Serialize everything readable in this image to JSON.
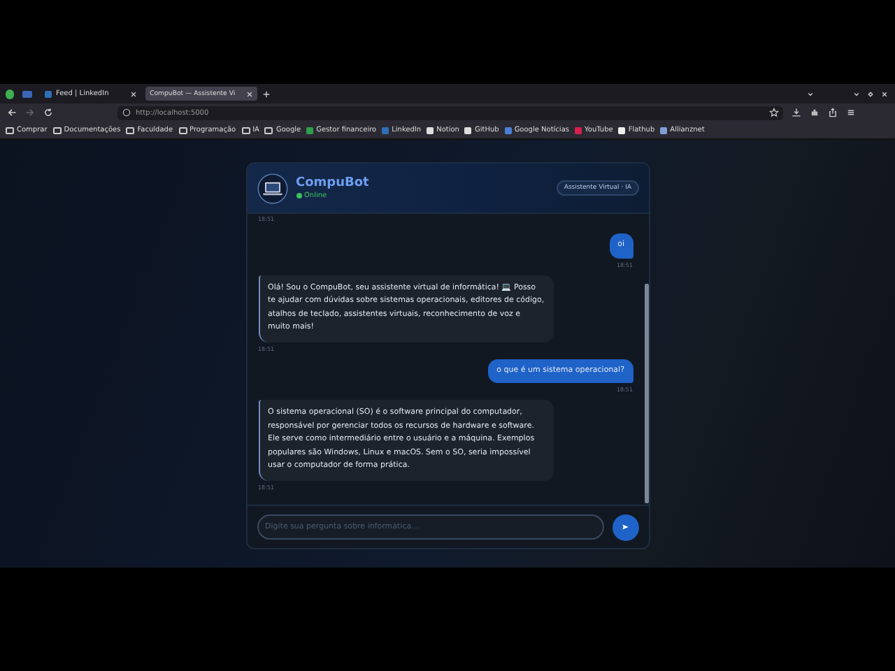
{
  "browser": {
    "tabs": [
      {
        "label": "Feed | LinkedIn",
        "selected": false
      },
      {
        "label": "CompuBot — Assistente Vi",
        "selected": true
      }
    ],
    "address": "http://localhost:5000",
    "bookmarks": [
      {
        "kind": "folder",
        "label": "Comprar"
      },
      {
        "kind": "folder",
        "label": "Documentações"
      },
      {
        "kind": "folder",
        "label": "Faculdade"
      },
      {
        "kind": "folder",
        "label": "Programação"
      },
      {
        "kind": "folder",
        "label": "IA"
      },
      {
        "kind": "folder",
        "label": "Google"
      },
      {
        "kind": "site",
        "label": "Gestor financeiro",
        "color": "#2e9e4f"
      },
      {
        "kind": "site",
        "label": "LinkedIn",
        "color": "#2f6fb5"
      },
      {
        "kind": "site",
        "label": "Notion",
        "color": "#dddddd"
      },
      {
        "kind": "site",
        "label": "GitHub",
        "color": "#dddddd"
      },
      {
        "kind": "site",
        "label": "Google Notícias",
        "color": "#4a7fd6"
      },
      {
        "kind": "site",
        "label": "YouTube",
        "color": "#d6204b"
      },
      {
        "kind": "site",
        "label": "Flathub",
        "color": "#eeeeee"
      },
      {
        "kind": "site",
        "label": "Allianznet",
        "color": "#7f9fd6"
      }
    ]
  },
  "chat": {
    "title": "CompuBot",
    "status": "Online",
    "badge": "Assistente Virtual · IA",
    "top_time": "18:51",
    "messages": [
      {
        "kind": "user",
        "text": "oi",
        "time": "18:51"
      },
      {
        "kind": "bot",
        "text": "Olá! Sou o CompuBot, seu assistente virtual de informática! 💻 Posso te ajudar com dúvidas sobre sistemas operacionais, editores de código, atalhos de teclado, assistentes virtuais, reconhecimento de voz e muito mais!",
        "time": "18:51"
      },
      {
        "kind": "user",
        "text": "o que é um sistema operacional?",
        "time": "18:51"
      },
      {
        "kind": "bot",
        "text": "O sistema operacional (SO) é o software principal do computador, responsável por gerenciar todos os recursos de hardware e software. Ele serve como intermediário entre o usuário e a máquina. Exemplos populares são Windows, Linux e macOS. Sem o SO, seria impossível usar o computador de forma prática.",
        "time": "18:51"
      }
    ],
    "placeholder": "Digite sua pergunta sobre informática..."
  }
}
